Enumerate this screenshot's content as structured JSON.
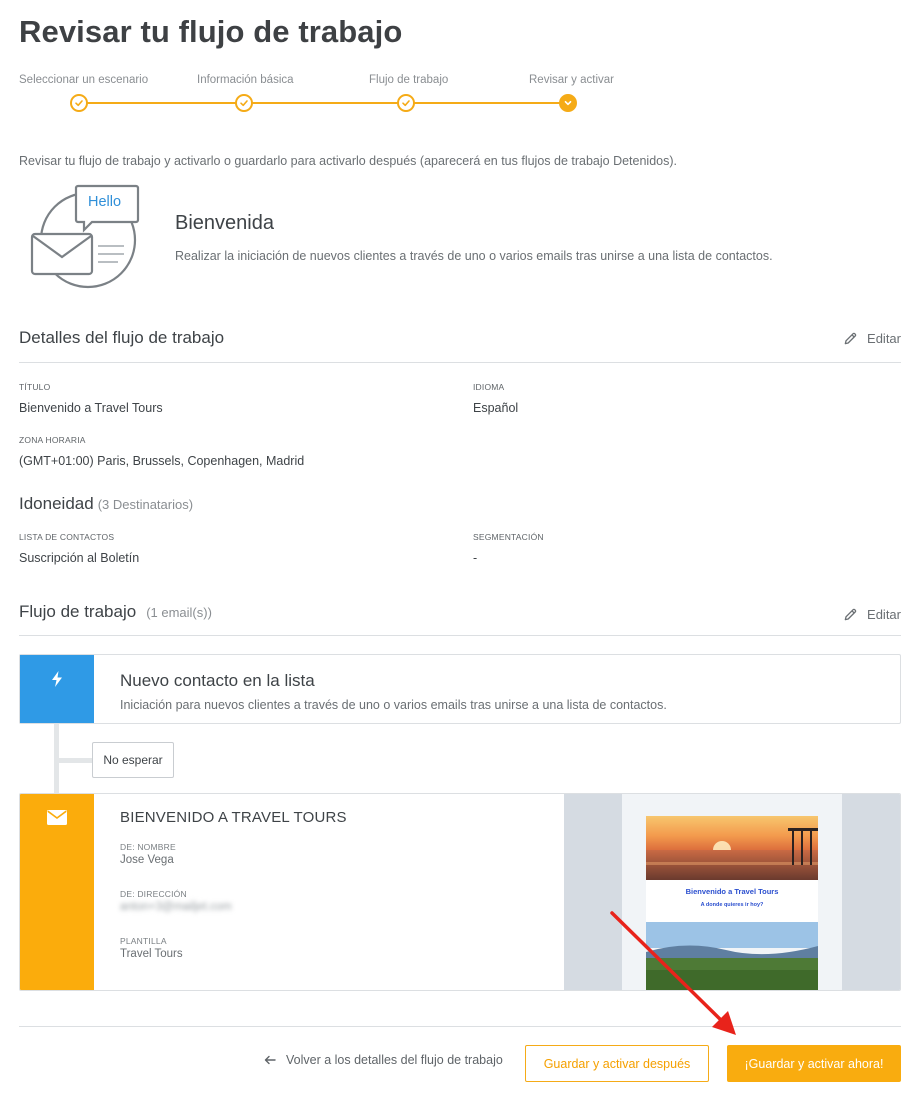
{
  "page": {
    "title": "Revisar tu flujo de trabajo"
  },
  "stepper": {
    "steps": [
      {
        "label": "Seleccionar un escenario",
        "state": "done"
      },
      {
        "label": "Información básica",
        "state": "done"
      },
      {
        "label": "Flujo de trabajo",
        "state": "done"
      },
      {
        "label": "Revisar y activar",
        "state": "current"
      }
    ],
    "accent_color": "#f5ab17"
  },
  "intro": {
    "text": "Revisar tu flujo de trabajo y activarlo o guardarlo para activarlo después (aparecerá en tus flujos de trabajo Detenidos)."
  },
  "template": {
    "illustration_text": "Hello",
    "title": "Bienvenida",
    "description": "Realizar la iniciación de nuevos clientes a través de uno o varios emails tras unirse a una lista de contactos."
  },
  "details": {
    "title": "Detalles del flujo de trabajo",
    "edit_label": "Editar",
    "title_label": "TÍTULO",
    "title_value": "Bienvenido a Travel Tours",
    "language_label": "IDIOMA",
    "language_value": "Español",
    "timezone_label": "ZONA HORARIA",
    "timezone_value": "(GMT+01:00) Paris, Brussels, Copenhagen, Madrid"
  },
  "eligibility": {
    "title": "Idoneidad",
    "subtitle": "(3 Destinatarios)",
    "list_label": "LISTA DE CONTACTOS",
    "list_value": "Suscripción al Boletín",
    "segment_label": "SEGMENTACIÓN",
    "segment_value": "-"
  },
  "workflow": {
    "title": "Flujo de trabajo",
    "subtitle": "(1 email(s))",
    "edit_label": "Editar",
    "trigger": {
      "icon": "lightning-icon",
      "title": "Nuevo contacto en la lista",
      "description": "Iniciación para nuevos clientes a través de uno o varios emails tras unirse a una lista de contactos.",
      "color": "#2f9ae6"
    },
    "wait": {
      "label": "No esperar"
    },
    "email": {
      "icon": "envelope-icon",
      "color": "#fbac0c",
      "title": "BIENVENIDO A TRAVEL TOURS",
      "from_name_label": "DE: NOMBRE",
      "from_name_value": "Jose Vega",
      "from_address_label": "DE: DIRECCIÓN",
      "from_address_value": "anton+3@mailjet.com",
      "template_label": "PLANTILLA",
      "template_value": "Travel Tours",
      "preview": {
        "heading": "Bienvenido a Travel Tours",
        "subheading": "A donde quieres ir hoy?"
      }
    }
  },
  "footer": {
    "back_label": "Volver a los detalles del flujo de trabajo",
    "save_later_label": "Guardar y activar después",
    "save_now_label": "¡Guardar y activar ahora!"
  }
}
